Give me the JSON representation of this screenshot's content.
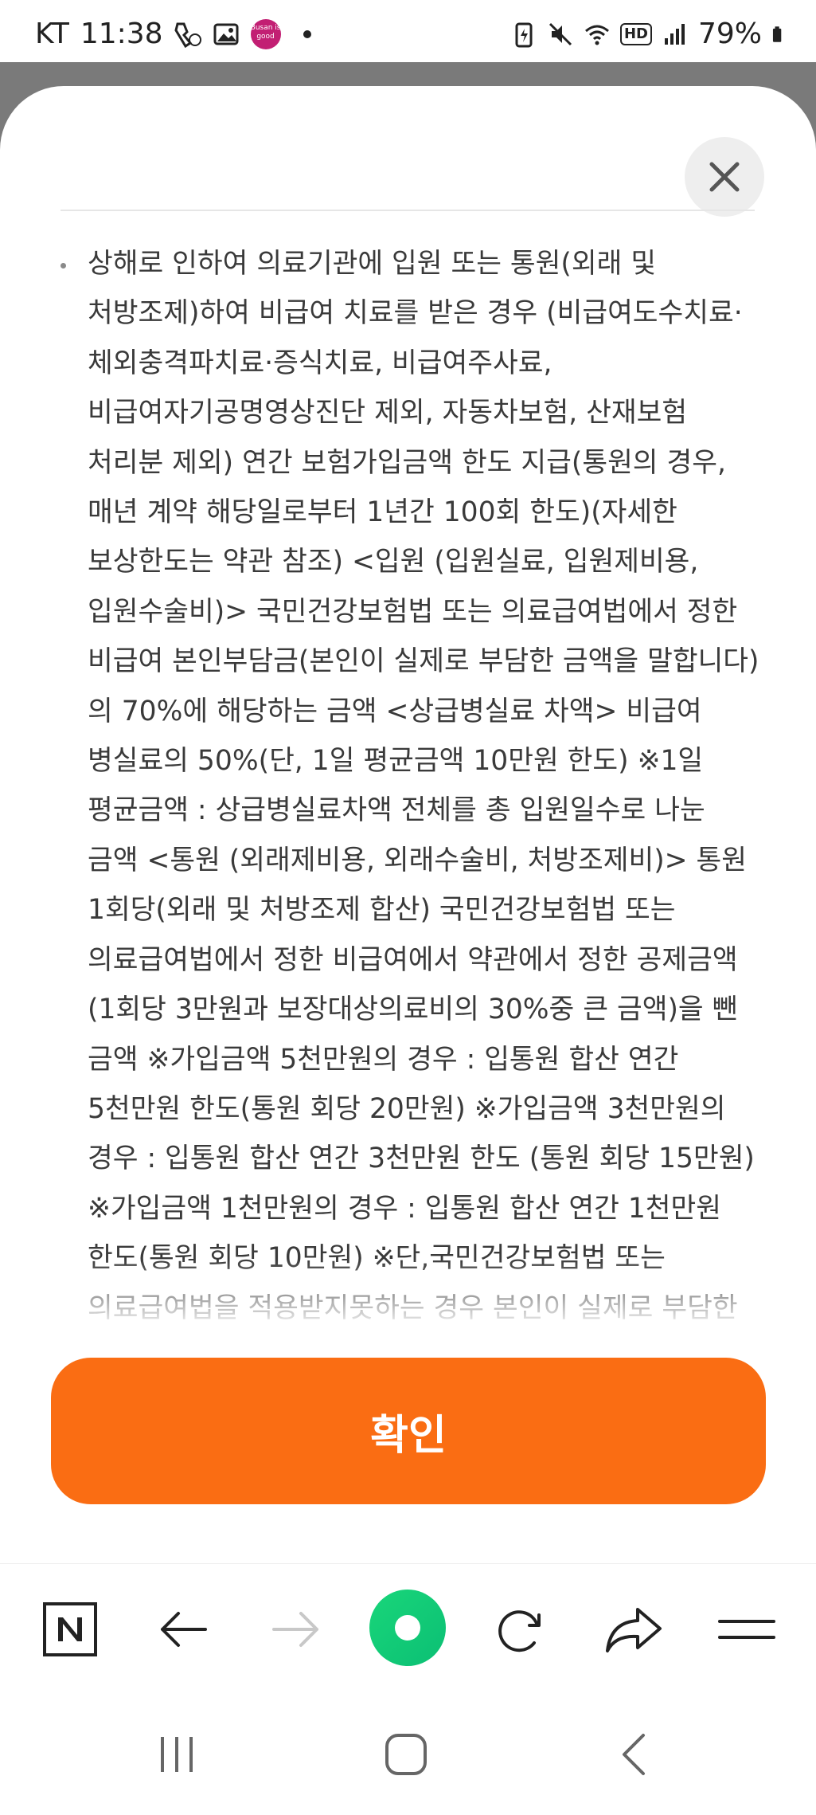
{
  "status_bar": {
    "carrier": "KT",
    "time": "11:38",
    "battery": "79%",
    "app_badge": "Busan is good",
    "network": "HD"
  },
  "modal": {
    "body_text": "상해로 인하여 의료기관에 입원 또는 통원(외래 및 처방조제)하여 비급여 치료를 받은 경우 (비급여도수치료·체외충격파치료·증식치료, 비급여주사료, 비급여자기공명영상진단 제외, 자동차보험, 산재보험 처리분 제외) 연간 보험가입금액 한도 지급(통원의 경우, 매년 계약 해당일로부터 1년간 100회 한도)(자세한 보상한도는 약관 참조) <입원 (입원실료, 입원제비용, 입원수술비)> 국민건강보험법 또는 의료급여법에서 정한 비급여 본인부담금(본인이 실제로 부담한 금액을 말합니다)의 70%에 해당하는 금액 <상급병실료 차액> 비급여 병실료의 50%(단, 1일 평균금액 10만원 한도) ※1일 평균금액 : 상급병실료차액 전체를 총 입원일수로 나눈 금액 <통원 (외래제비용, 외래수술비, 처방조제비)> 통원 1회당(외래 및 처방조제 합산) 국민건강보험법 또는 의료급여법에서 정한 비급여에서 약관에서 정한 공제금액(1회당 3만원과 보장대상의료비의 30%중 큰 금액)을 뺀 금액 ※가입금액 5천만원의 경우 : 입통원 합산 연간 5천만원 한도(통원 회당 20만원) ※가입금액 3천만원의 경우 : 입통원 합산 연간 3천만원 한도 (통원 회당 15만원) ※가입금액 1천만원의 경우 : 입통원 합산 연간 1천만원 한도(통원 회당 10만원) ※단,국민건강보험법 또는 의료급여법을 적용받지못하는 경우 본인이 실제로 부담한 금액",
    "confirm_label": "확인",
    "accent_color": "#fa6d13"
  },
  "browser_toolbar": {
    "items": [
      "naver-home-icon",
      "back-arrow-icon",
      "forward-arrow-icon",
      "green-dot-icon",
      "refresh-icon",
      "share-icon",
      "menu-icon"
    ]
  },
  "system_nav": {
    "items": [
      "recent-apps-icon",
      "home-icon",
      "back-icon"
    ]
  }
}
